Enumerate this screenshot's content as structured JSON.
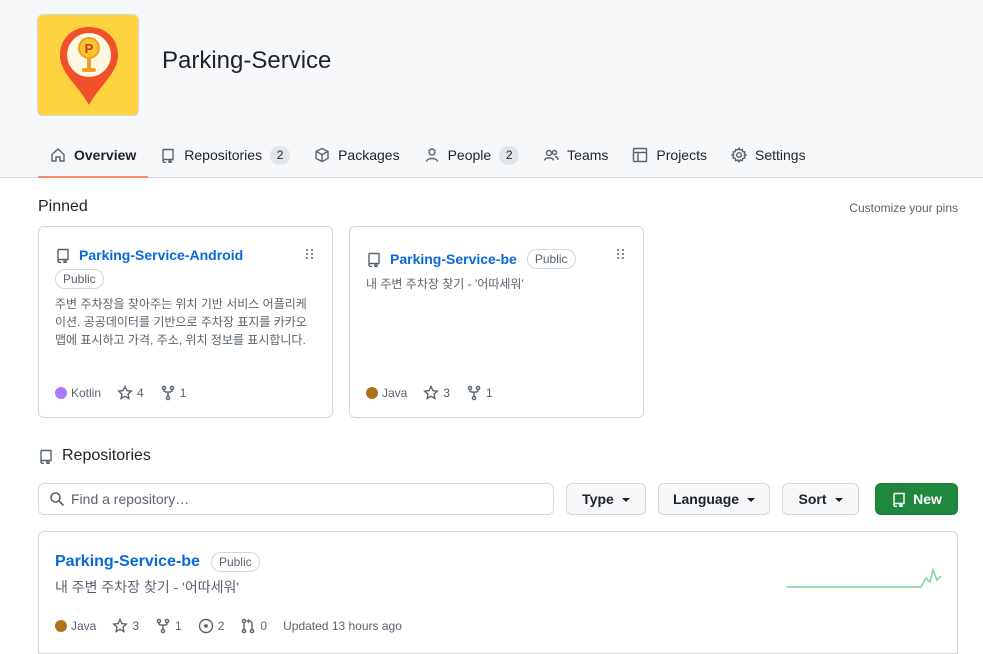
{
  "org": {
    "name": "Parking-Service"
  },
  "nav": [
    {
      "label": "Overview",
      "count": null
    },
    {
      "label": "Repositories",
      "count": "2"
    },
    {
      "label": "Packages",
      "count": null
    },
    {
      "label": "People",
      "count": "2"
    },
    {
      "label": "Teams",
      "count": null
    },
    {
      "label": "Projects",
      "count": null
    },
    {
      "label": "Settings",
      "count": null
    }
  ],
  "pinned": {
    "title": "Pinned",
    "customize_label": "Customize your pins",
    "cards": [
      {
        "name": "Parking-Service-Android",
        "visibility": "Public",
        "description": "주변 주차장을 찾아주는 위치 기반 서비스 어플리케이션. 공공데이터를 기반으로 주차장 표지를 카카오맵에 표시하고 가격, 주소, 위치 정보를 표시합니다.",
        "language": "Kotlin",
        "language_color": "#A97BFF",
        "stars": "4",
        "forks": "1"
      },
      {
        "name": "Parking-Service-be",
        "visibility": "Public",
        "description": "내 주변 주차장 찾기 - '어따세워'",
        "language": "Java",
        "language_color": "#b07219",
        "stars": "3",
        "forks": "1"
      }
    ]
  },
  "repositories": {
    "heading": "Repositories",
    "search_placeholder": "Find a repository…",
    "type_label": "Type",
    "language_label": "Language",
    "sort_label": "Sort",
    "new_label": "New",
    "items": [
      {
        "name": "Parking-Service-be",
        "visibility": "Public",
        "description": "내 주변 주차장 찾기 - '어따세워'",
        "language": "Java",
        "language_color": "#b07219",
        "stars": "3",
        "forks": "1",
        "issues": "2",
        "pull_requests": "0",
        "updated": "Updated 13 hours ago"
      }
    ]
  },
  "colors": {
    "accent_underline": "#fd8c73",
    "link": "#0969da",
    "new_button": "#1f883d",
    "avatar_bg": "#ffd23f"
  }
}
